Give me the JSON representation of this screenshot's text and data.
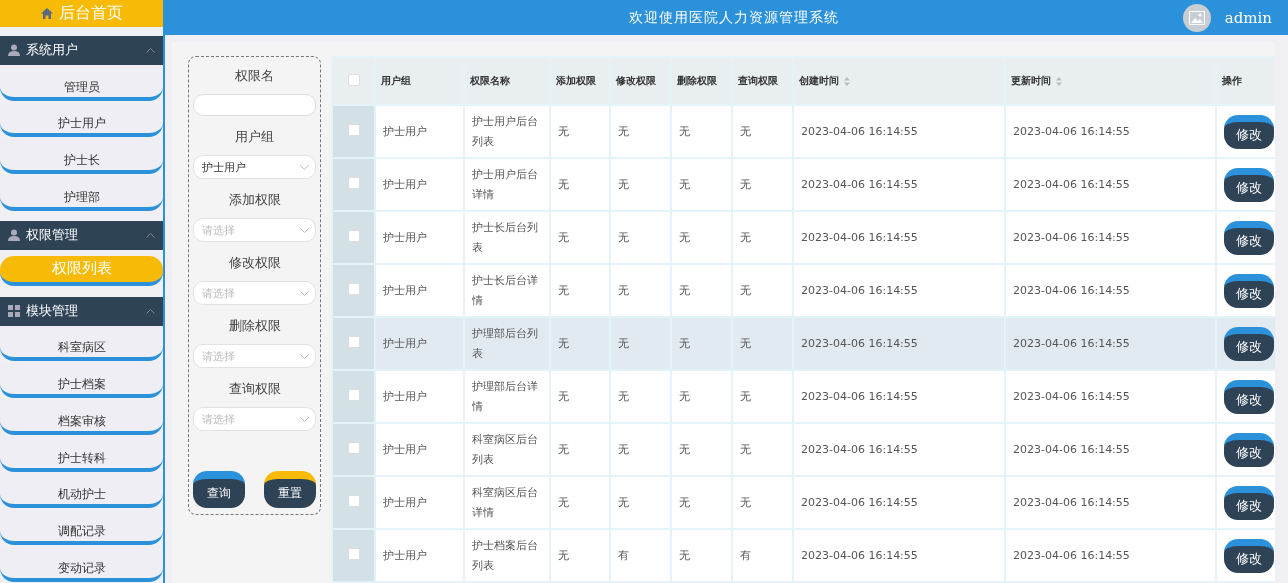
{
  "header": {
    "title": "欢迎使用医院人力资源管理系统",
    "username": "admin"
  },
  "sidebar": {
    "home": "后台首页",
    "groups": [
      {
        "title": "系统用户",
        "kind": "user",
        "expanded": true,
        "items": [
          {
            "label": "管理员",
            "selected": false
          },
          {
            "label": "护士用户",
            "selected": false
          },
          {
            "label": "护士长",
            "selected": false
          },
          {
            "label": "护理部",
            "selected": false
          }
        ]
      },
      {
        "title": "权限管理",
        "kind": "user",
        "expanded": true,
        "items": [
          {
            "label": "权限列表",
            "selected": true
          }
        ]
      },
      {
        "title": "模块管理",
        "kind": "grid",
        "expanded": true,
        "items": [
          {
            "label": "科室病区",
            "selected": false
          },
          {
            "label": "护士档案",
            "selected": false
          },
          {
            "label": "档案审核",
            "selected": false
          },
          {
            "label": "护士转科",
            "selected": false
          },
          {
            "label": "机动护士",
            "selected": false
          },
          {
            "label": "调配记录",
            "selected": false
          },
          {
            "label": "变动记录",
            "selected": false
          }
        ]
      }
    ]
  },
  "filters": [
    {
      "label": "权限名",
      "kind": "text"
    },
    {
      "label": "用户组",
      "kind": "select",
      "value": "护士用户"
    },
    {
      "label": "添加权限",
      "kind": "select",
      "placeholder": "请选择"
    },
    {
      "label": "修改权限",
      "kind": "select",
      "placeholder": "请选择"
    },
    {
      "label": "删除权限",
      "kind": "select",
      "placeholder": "请选择"
    },
    {
      "label": "查询权限",
      "kind": "select",
      "placeholder": "请选择"
    }
  ],
  "filter_buttons": [
    {
      "label": "查询",
      "kind": "primary"
    },
    {
      "label": "重置",
      "kind": "warning"
    }
  ],
  "table": {
    "all_checked": false,
    "columns": [
      {
        "label": "用户组",
        "sortable": false
      },
      {
        "label": "权限名称",
        "sortable": false
      },
      {
        "label": "添加权限",
        "sortable": false
      },
      {
        "label": "修改权限",
        "sortable": false
      },
      {
        "label": "删除权限",
        "sortable": false
      },
      {
        "label": "查询权限",
        "sortable": false
      },
      {
        "label": "创建时间",
        "sortable": true
      },
      {
        "label": "更新时间",
        "sortable": true
      },
      {
        "label": "操作",
        "sortable": false
      }
    ],
    "rows": [
      {
        "checked": false,
        "hovered": false,
        "cells": [
          "护士用户",
          "护士用户后台列表",
          "无",
          "无",
          "无",
          "无",
          "2023-04-06 16:14:55",
          "2023-04-06 16:14:55"
        ],
        "action": "修改"
      },
      {
        "checked": false,
        "hovered": false,
        "cells": [
          "护士用户",
          "护士用户后台详情",
          "无",
          "无",
          "无",
          "无",
          "2023-04-06 16:14:55",
          "2023-04-06 16:14:55"
        ],
        "action": "修改"
      },
      {
        "checked": false,
        "hovered": false,
        "cells": [
          "护士用户",
          "护士长后台列表",
          "无",
          "无",
          "无",
          "无",
          "2023-04-06 16:14:55",
          "2023-04-06 16:14:55"
        ],
        "action": "修改"
      },
      {
        "checked": false,
        "hovered": false,
        "cells": [
          "护士用户",
          "护士长后台详情",
          "无",
          "无",
          "无",
          "无",
          "2023-04-06 16:14:55",
          "2023-04-06 16:14:55"
        ],
        "action": "修改"
      },
      {
        "checked": false,
        "hovered": true,
        "cells": [
          "护士用户",
          "护理部后台列表",
          "无",
          "无",
          "无",
          "无",
          "2023-04-06 16:14:55",
          "2023-04-06 16:14:55"
        ],
        "action": "修改"
      },
      {
        "checked": false,
        "hovered": false,
        "cells": [
          "护士用户",
          "护理部后台详情",
          "无",
          "无",
          "无",
          "无",
          "2023-04-06 16:14:55",
          "2023-04-06 16:14:55"
        ],
        "action": "修改"
      },
      {
        "checked": false,
        "hovered": false,
        "cells": [
          "护士用户",
          "科室病区后台列表",
          "无",
          "无",
          "无",
          "无",
          "2023-04-06 16:14:55",
          "2023-04-06 16:14:55"
        ],
        "action": "修改"
      },
      {
        "checked": false,
        "hovered": false,
        "cells": [
          "护士用户",
          "科室病区后台详情",
          "无",
          "无",
          "无",
          "无",
          "2023-04-06 16:14:55",
          "2023-04-06 16:14:55"
        ],
        "action": "修改"
      },
      {
        "checked": false,
        "hovered": false,
        "cells": [
          "护士用户",
          "护士档案后台列表",
          "无",
          "有",
          "无",
          "有",
          "2023-04-06 16:14:55",
          "2023-04-06 16:14:55"
        ],
        "action": "修改"
      }
    ]
  }
}
